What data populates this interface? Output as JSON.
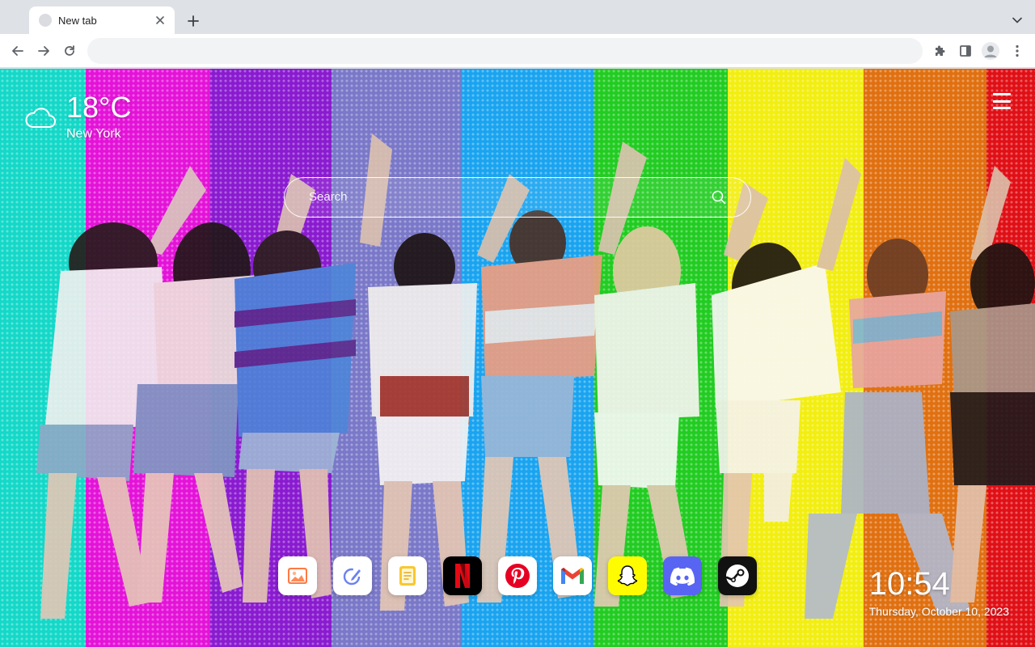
{
  "browser": {
    "tab": {
      "title": "New tab"
    },
    "omnibox": {
      "value": "",
      "placeholder": ""
    }
  },
  "background": {
    "stripe_colors": [
      "#14d8c8",
      "#e413d8",
      "#8a1bd0",
      "#7a78c8",
      "#1aa4f0",
      "#22cc22",
      "#f2ee10",
      "#e07010",
      "#e01016"
    ]
  },
  "weather": {
    "temperature": "18°C",
    "city": "New York",
    "icon": "cloud-icon"
  },
  "search": {
    "placeholder": "Search",
    "icon": "search-icon"
  },
  "menu": {
    "icon": "hamburger-menu-icon"
  },
  "dock": {
    "apps": [
      {
        "name": "gallery",
        "icon": "image-icon",
        "color": "#ffffff"
      },
      {
        "name": "edit",
        "icon": "pen-icon",
        "color": "#ffffff"
      },
      {
        "name": "notes",
        "icon": "note-icon",
        "color": "#ffffff"
      },
      {
        "name": "netflix",
        "icon": "netflix-icon",
        "color": "#000000"
      },
      {
        "name": "pinterest",
        "icon": "pinterest-icon",
        "color": "#ffffff"
      },
      {
        "name": "gmail",
        "icon": "gmail-icon",
        "color": "#ffffff"
      },
      {
        "name": "snapchat",
        "icon": "snapchat-icon",
        "color": "#fffc00"
      },
      {
        "name": "discord",
        "icon": "discord-icon",
        "color": "#5865f2"
      },
      {
        "name": "steam",
        "icon": "steam-icon",
        "color": "#111111"
      }
    ]
  },
  "clock": {
    "time": "10:54",
    "date": "Thursday, October 10, 2023"
  }
}
